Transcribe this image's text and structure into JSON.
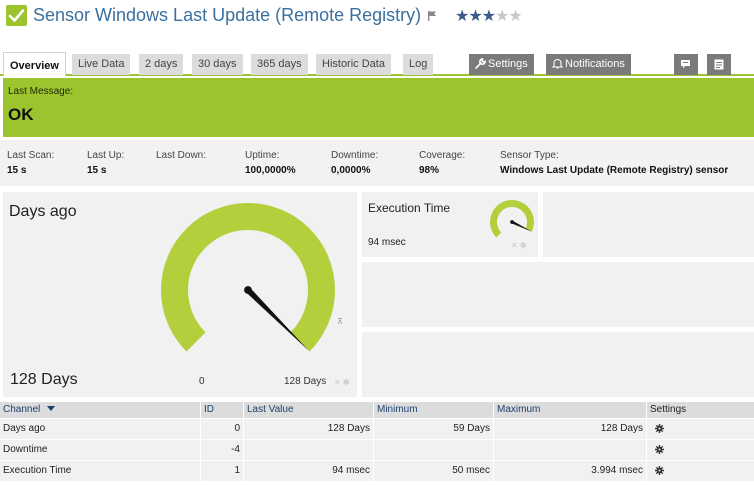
{
  "header": {
    "title": "Sensor Windows Last Update (Remote Registry)",
    "priority_stars": 3,
    "priority_max": 5,
    "status_color": "#9cc42e"
  },
  "tabs": [
    {
      "label": "Overview",
      "active": true
    },
    {
      "label": "Live Data"
    },
    {
      "label": "2 days"
    },
    {
      "label": "30 days"
    },
    {
      "label": "365 days"
    },
    {
      "label": "Historic Data"
    },
    {
      "label": "Log"
    },
    {
      "label": "Settings",
      "icon": "wrench-icon"
    },
    {
      "label": "Notifications",
      "icon": "bell-icon"
    },
    {
      "label": "",
      "icon": "comment-icon"
    },
    {
      "label": "",
      "icon": "notes-icon"
    }
  ],
  "message": {
    "label": "Last Message:",
    "value": "OK"
  },
  "stats": [
    {
      "label": "Last Scan:",
      "value": "15 s"
    },
    {
      "label": "Last Up:",
      "value": "15 s"
    },
    {
      "label": "Last Down:",
      "value": ""
    },
    {
      "label": "Uptime:",
      "value": "100,0000%"
    },
    {
      "label": "Downtime:",
      "value": "0,0000%"
    },
    {
      "label": "Coverage:",
      "value": "98%"
    },
    {
      "label": "Sensor Type:",
      "value": "Windows Last Update (Remote Registry) sensor"
    }
  ],
  "gauge_main": {
    "title": "Days ago",
    "value_text": "128 Days",
    "min_text": "0",
    "max_text": "128 Days",
    "fill_fraction": 1.0,
    "color": "#b4cf3c"
  },
  "gauge_exec": {
    "title": "Execution Time",
    "value_text": "94 msec",
    "fill_fraction": 0.93,
    "color": "#b4cf3c"
  },
  "table": {
    "headers": {
      "channel": "Channel",
      "id": "ID",
      "last_value": "Last Value",
      "minimum": "Minimum",
      "maximum": "Maximum",
      "settings": "Settings"
    },
    "rows": [
      {
        "channel": "Days ago",
        "id": "0",
        "last_value": "128 Days",
        "minimum": "59 Days",
        "maximum": "128 Days"
      },
      {
        "channel": "Downtime",
        "id": "-4",
        "last_value": "",
        "minimum": "",
        "maximum": ""
      },
      {
        "channel": "Execution Time",
        "id": "1",
        "last_value": "94 msec",
        "minimum": "50 msec",
        "maximum": "3.994 msec"
      }
    ]
  }
}
